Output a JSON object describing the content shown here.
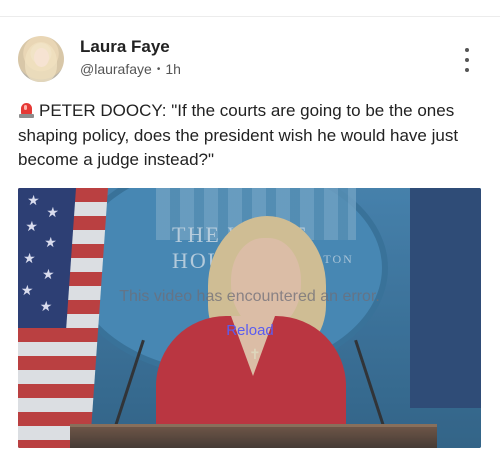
{
  "post": {
    "author": {
      "name": "Laura Faye",
      "handle": "@laurafaye",
      "separator": "•",
      "time": "1h"
    },
    "more_icon": "more-vertical-icon",
    "siren_icon": "rotating-light-icon",
    "text": "PETER DOOCY: \"If the courts are going to be the ones shaping policy, does the president wish he would have just become a judge instead?\"",
    "video": {
      "error_message": "This video has encountered an error.",
      "reload_label": "Reload",
      "backdrop_text": "THE WHITE HOUSE",
      "backdrop_subtext": "WASHINGTON"
    }
  },
  "colors": {
    "link_accent": "#5a5cf0",
    "siren_red": "#e53935"
  }
}
